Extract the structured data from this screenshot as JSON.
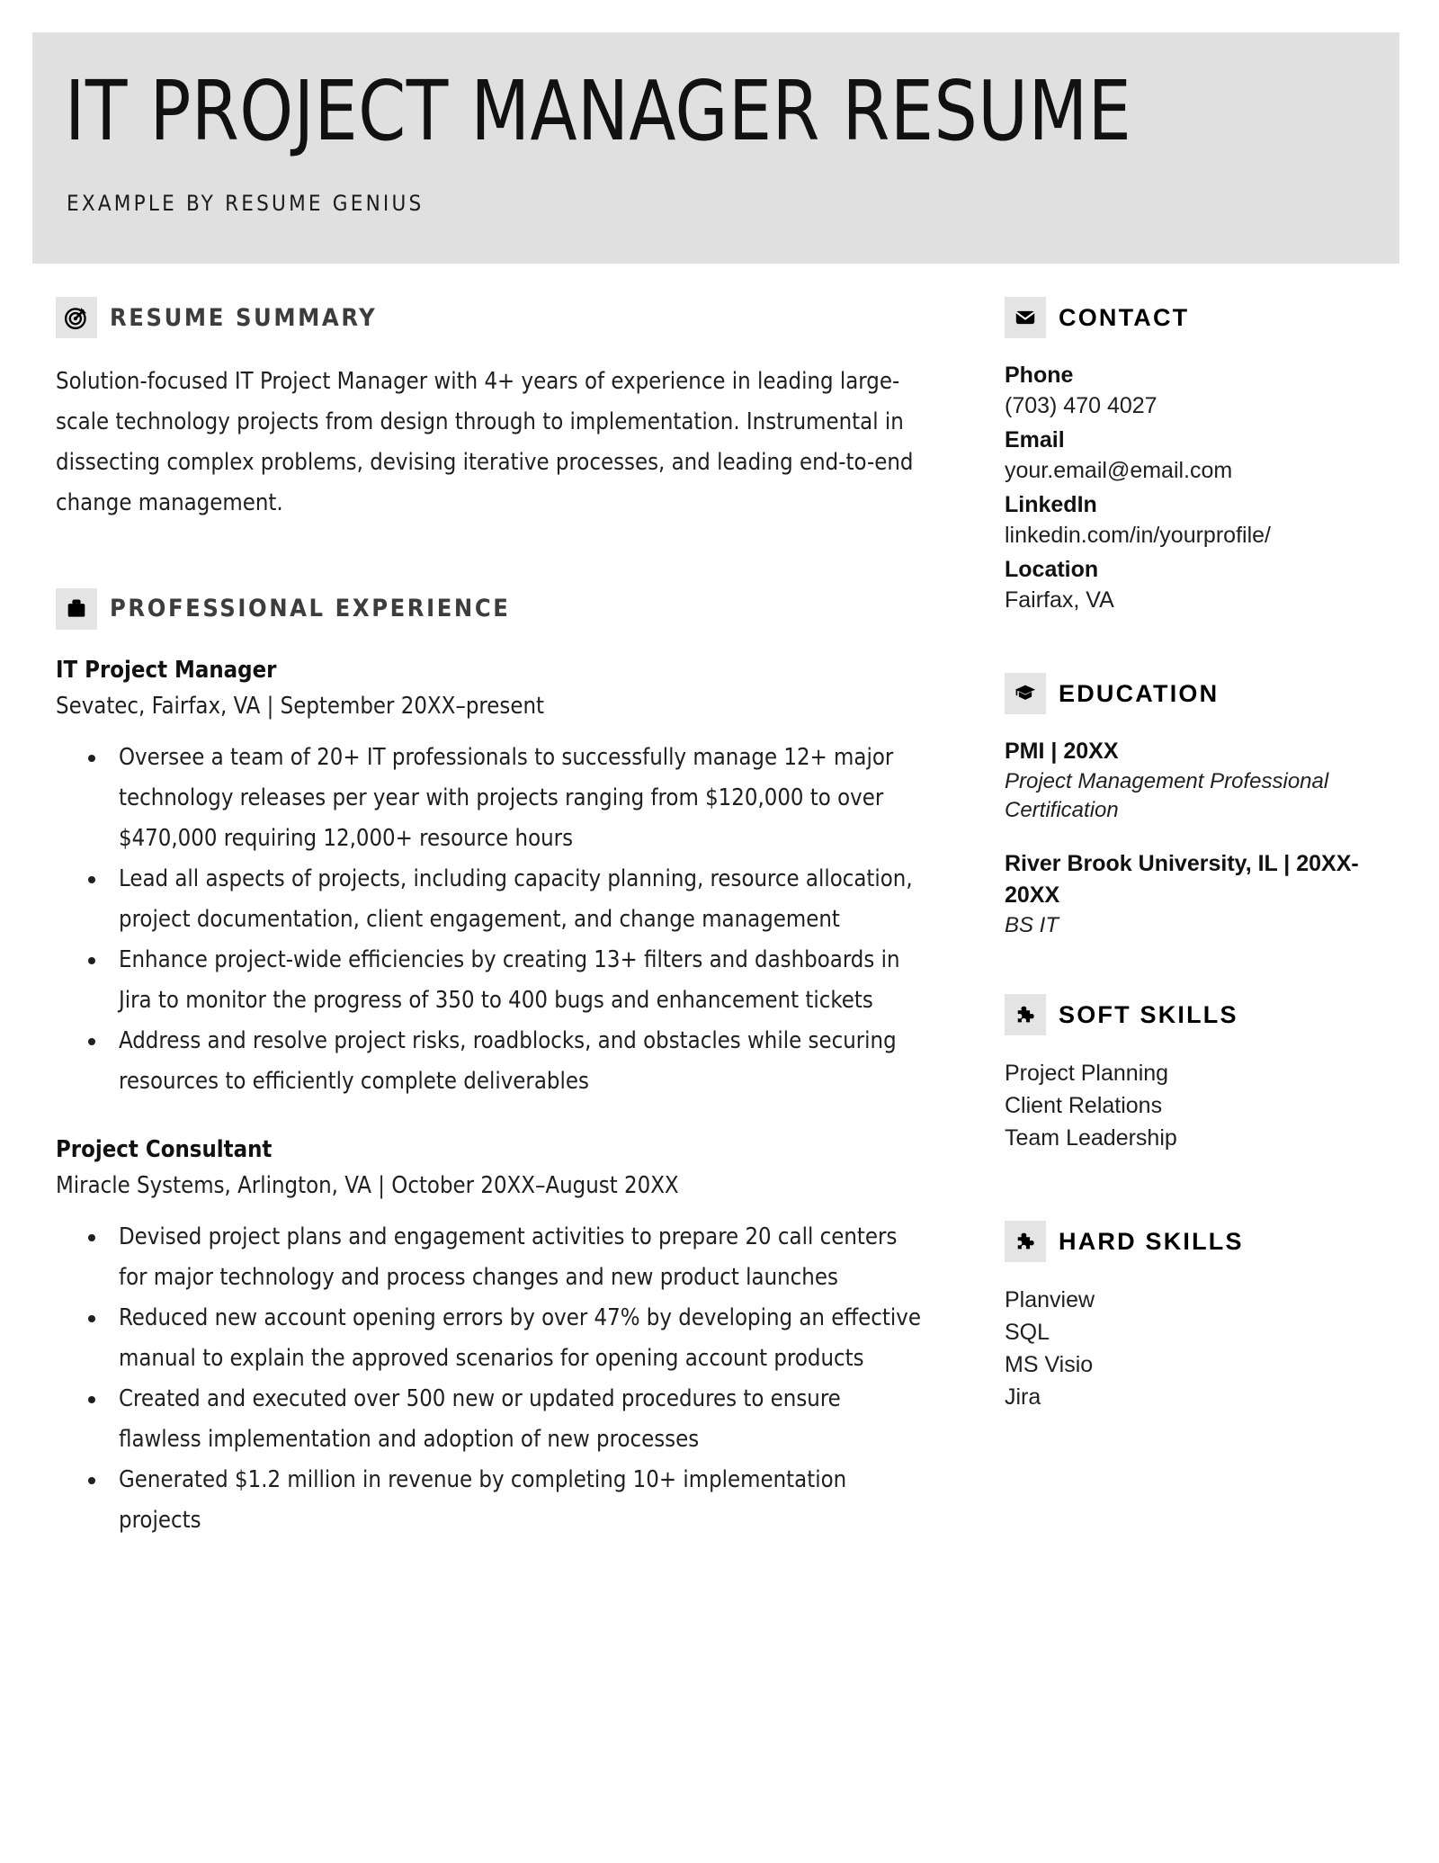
{
  "header": {
    "title": "IT PROJECT MANAGER RESUME",
    "subtitle": "EXAMPLE BY RESUME GENIUS",
    "band_color": "#e0e0e0"
  },
  "theme": {
    "icon_box_color": "#e4e4e4",
    "main_heading_color": "#3d3d3d",
    "side_heading_color": "#000000",
    "body_color": "#1f1f1f"
  },
  "main": {
    "summary": {
      "icon": "target-icon",
      "heading": "RESUME SUMMARY",
      "text": "Solution-focused IT Project Manager with 4+ years of experience in leading large-scale technology projects from design through to implementation. Instrumental in dissecting complex problems, devising iterative processes, and leading end-to-end change management."
    },
    "experience": {
      "icon": "briefcase-icon",
      "heading": "PROFESSIONAL EXPERIENCE",
      "jobs": [
        {
          "title": "IT Project Manager",
          "meta": "Sevatec, Fairfax, VA | September 20XX–present",
          "bullets": [
            "Oversee a team of 20+ IT professionals to successfully manage 12+ major technology releases per year with projects ranging from $120,000 to over $470,000 requiring 12,000+ resource hours",
            "Lead all aspects of projects, including capacity planning, resource allocation, project documentation, client engagement, and change management",
            "Enhance project-wide efficiencies by creating 13+ filters and dashboards in Jira to monitor the progress of 350 to 400 bugs and enhancement tickets",
            "Address and resolve project risks, roadblocks, and obstacles while securing resources to efficiently complete deliverables"
          ]
        },
        {
          "title": "Project Consultant",
          "meta": "Miracle Systems, Arlington, VA | October 20XX–August 20XX",
          "bullets": [
            "Devised project plans and engagement activities to prepare 20 call centers for major technology and process changes and new product launches",
            "Reduced new account opening errors by over 47% by developing an effective manual to explain the approved scenarios for opening account products",
            "Created and executed over 500 new or updated procedures to ensure flawless implementation and adoption of new processes",
            "Generated $1.2 million in revenue by completing 10+ implementation projects"
          ]
        }
      ]
    }
  },
  "sidebar": {
    "contact": {
      "icon": "envelope-icon",
      "heading": "CONTACT",
      "fields": [
        {
          "label": "Phone",
          "value": "(703) 470 4027"
        },
        {
          "label": "Email",
          "value": "your.email@email.com"
        },
        {
          "label": "LinkedIn",
          "value": "linkedin.com/in/yourprofile/"
        },
        {
          "label": "Location",
          "value": "Fairfax, VA"
        }
      ]
    },
    "education": {
      "icon": "graduation-cap-icon",
      "heading": "EDUCATION",
      "entries": [
        {
          "name": "PMI | 20XX",
          "degree": "Project Management Professional Certification"
        },
        {
          "name": "River Brook University, IL | 20XX-20XX",
          "degree": "BS IT"
        }
      ]
    },
    "soft_skills": {
      "icon": "puzzle-piece-icon",
      "heading": "SOFT SKILLS",
      "items": [
        "Project Planning",
        "Client Relations",
        "Team Leadership"
      ]
    },
    "hard_skills": {
      "icon": "puzzle-piece-icon",
      "heading": "HARD SKILLS",
      "items": [
        "Planview",
        "SQL",
        "MS Visio",
        "Jira"
      ]
    }
  }
}
